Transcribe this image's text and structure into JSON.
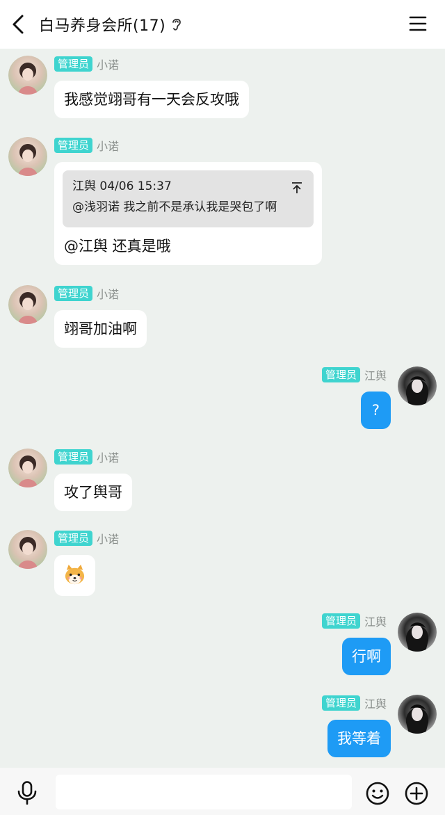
{
  "header": {
    "title": "白马养身会所(17)",
    "back_icon": "chevron-left-icon",
    "ear_icon": "ear-icon",
    "menu_icon": "hamburger-menu-icon"
  },
  "colors": {
    "badge": "#3fd4cf",
    "bubble_self": "#1e9bf5",
    "bubble_other": "#ffffff",
    "background": "#edf1ee"
  },
  "messages": [
    {
      "side": "left",
      "badge": "管理员",
      "sender": "小诺",
      "text": "我感觉翊哥有一天会反攻哦"
    },
    {
      "side": "left",
      "badge": "管理员",
      "sender": "小诺",
      "quote": {
        "author_time": "江舆 04/06 15:37",
        "text": "@浅羽诺 我之前不是承认我是哭包了啊"
      },
      "text": "@江舆 还真是哦"
    },
    {
      "side": "left",
      "badge": "管理员",
      "sender": "小诺",
      "text": "翊哥加油啊"
    },
    {
      "side": "right",
      "badge": "管理员",
      "sender": "江舆",
      "text": "?"
    },
    {
      "side": "left",
      "badge": "管理员",
      "sender": "小诺",
      "text": "攻了舆哥"
    },
    {
      "side": "left",
      "badge": "管理员",
      "sender": "小诺",
      "sticker": "shiba-dog-emoji"
    },
    {
      "side": "right",
      "badge": "管理员",
      "sender": "江舆",
      "text": "行啊"
    },
    {
      "side": "right",
      "badge": "管理员",
      "sender": "江舆",
      "text": "我等着"
    }
  ],
  "input": {
    "value": "",
    "placeholder": "",
    "mic_icon": "microphone-icon",
    "emoji_icon": "smiley-icon",
    "plus_icon": "plus-circle-icon"
  }
}
